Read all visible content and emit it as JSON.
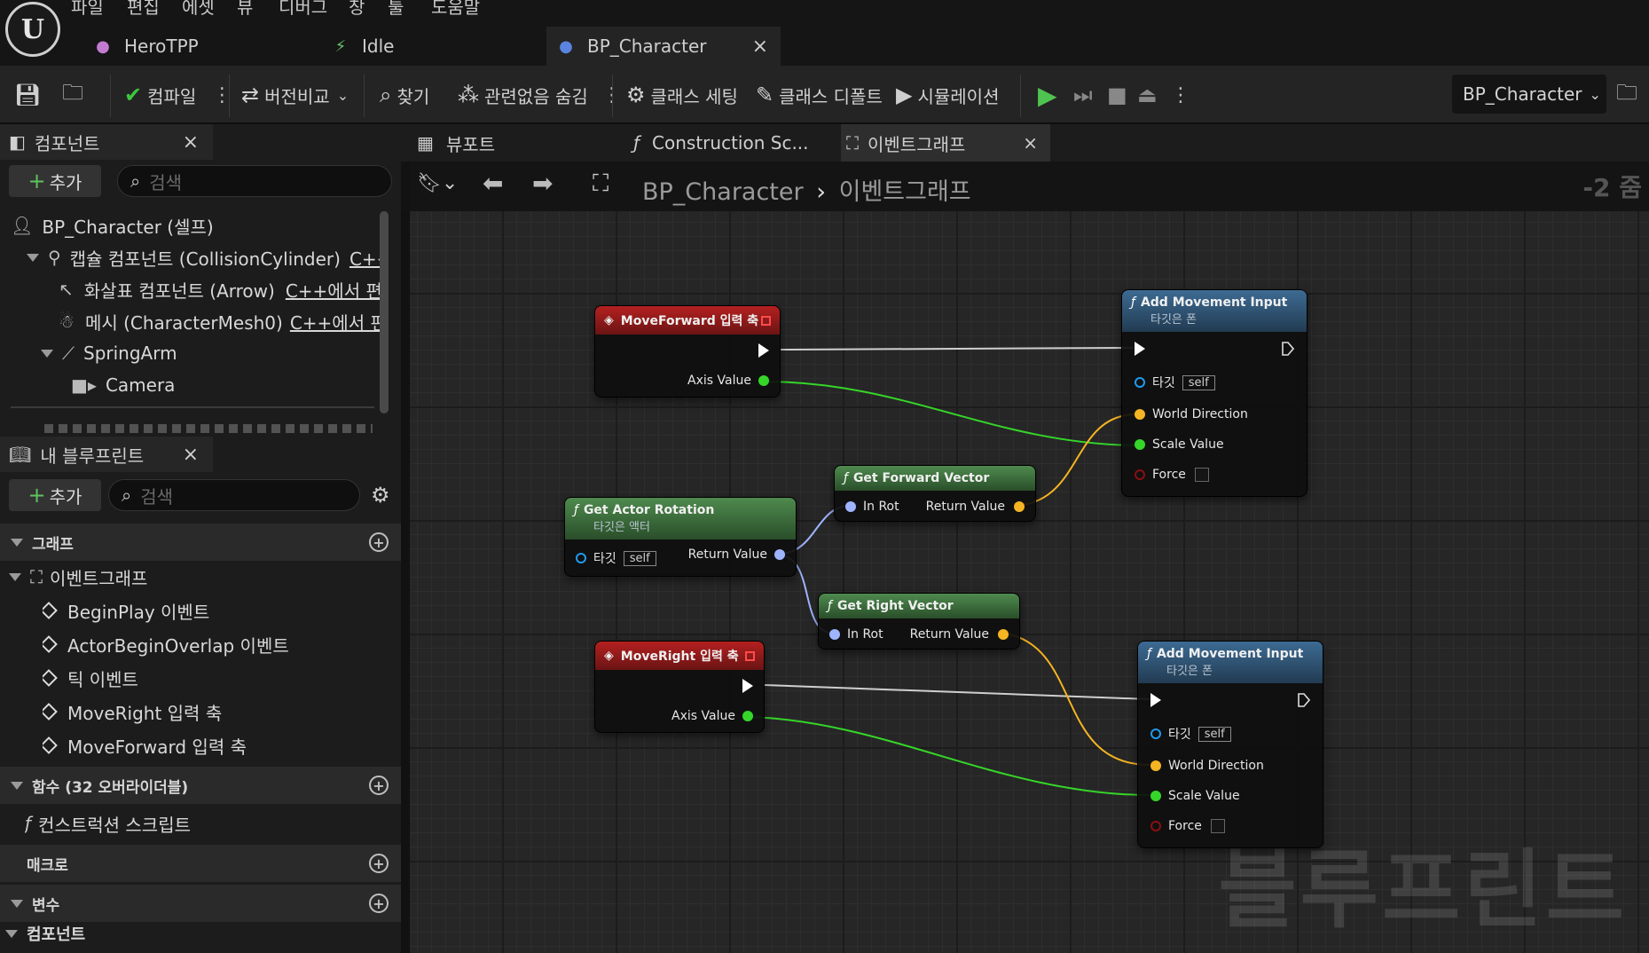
{
  "menu": [
    "파일",
    "편집",
    "에셋",
    "뷰",
    "디버그",
    "창",
    "툴",
    "도움말"
  ],
  "doc_tabs": [
    {
      "label": "HeroTPP"
    },
    {
      "label": "Idle"
    },
    {
      "label": "BP_Character",
      "close": "×"
    }
  ],
  "toolbar": {
    "compile": "컴파일",
    "diff": "버전비교",
    "find": "찾기",
    "hide_unrelated": "관련없음 숨김",
    "class_settings": "클래스 세팅",
    "class_defaults": "클래스 디폴트",
    "simulation": "시뮬레이션",
    "bp_select": "BP_Character"
  },
  "components_panel": {
    "title": "컴포넌트",
    "close": "×",
    "add": "추가",
    "search_placeholder": "검색",
    "items": [
      {
        "label": "BP_Character (셀프)"
      },
      {
        "label": "캡슐 컴포넌트 (CollisionCylinder)",
        "note": "C++에"
      },
      {
        "label": "화살표 컴포넌트 (Arrow)",
        "note": "C++에서 편"
      },
      {
        "label": "메시 (CharacterMesh0)",
        "note": "C++에서 편집"
      },
      {
        "label": "SpringArm"
      },
      {
        "label": "Camera"
      }
    ]
  },
  "my_blueprint": {
    "title": "내 블루프린트",
    "close": "×",
    "add": "추가",
    "search_placeholder": "검색",
    "graphs_section": "그래프",
    "event_graph": "이벤트그래프",
    "events": [
      "BeginPlay 이벤트",
      "ActorBeginOverlap 이벤트",
      "틱 이벤트",
      "MoveRight 입력 축",
      "MoveForward 입력 축"
    ],
    "functions_section": "함수 (32 오버라이더블)",
    "construction_script": "컨스트럭션 스크립트",
    "macros_section": "매크로",
    "variables_section": "변수",
    "components_section": "컴포넌트"
  },
  "graph_tabs": [
    {
      "label": "뷰포트"
    },
    {
      "label": "Construction Sc..."
    },
    {
      "label": "이벤트그래프",
      "close": "×"
    }
  ],
  "breadcrumb": {
    "root": "BP_Character",
    "current": "이벤트그래프"
  },
  "zoom": "-2 줌",
  "watermark": "블루프린트",
  "nodes": {
    "move_forward": {
      "title": "MoveForward 입력 축",
      "pin": "Axis Value"
    },
    "get_actor_rotation": {
      "title": "Get Actor Rotation",
      "subtitle": "타깃은 액터",
      "target": "타깃",
      "self": "self",
      "out": "Return Value"
    },
    "get_forward_vector": {
      "title": "Get Forward Vector",
      "in": "In Rot",
      "out": "Return Value"
    },
    "get_right_vector": {
      "title": "Get Right Vector",
      "in": "In Rot",
      "out": "Return Value"
    },
    "move_right": {
      "title": "MoveRight 입력 축",
      "pin": "Axis Value"
    },
    "add_movement_1": {
      "title": "Add Movement Input",
      "subtitle": "타깃은 폰",
      "target": "타깃",
      "self": "self",
      "world_direction": "World Direction",
      "scale_value": "Scale Value",
      "force": "Force"
    },
    "add_movement_2": {
      "title": "Add Movement Input",
      "subtitle": "타깃은 폰",
      "target": "타깃",
      "self": "self",
      "world_direction": "World Direction",
      "scale_value": "Scale Value",
      "force": "Force"
    }
  },
  "colors": {
    "exec": "#ffffff",
    "float": "#35d629",
    "vector": "#f5b422",
    "rotator": "#9fb4ff",
    "bool": "#8b0f0f",
    "object": "#1f9bf0"
  }
}
